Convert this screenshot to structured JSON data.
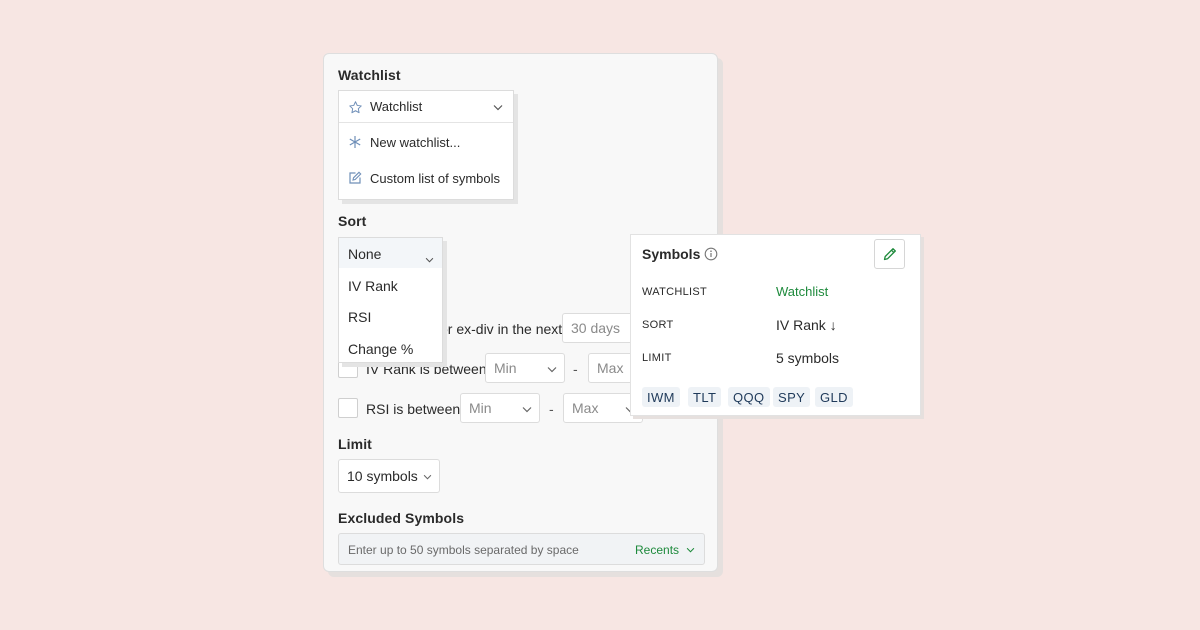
{
  "watchlist": {
    "section_label": "Watchlist",
    "selected": "Watchlist",
    "options": [
      "New watchlist...",
      "Custom list of symbols"
    ]
  },
  "sort": {
    "section_label": "Sort",
    "selected": "None",
    "options": [
      "IV Rank",
      "RSI",
      "Change %"
    ]
  },
  "filters": {
    "earnings_suffix": "or ex-div in the next",
    "earnings_days": "30 days",
    "iv_rank_label": "IV Rank is between",
    "rsi_label": "RSI is between",
    "min_placeholder": "Min",
    "max_placeholder": "Max",
    "dash": "-"
  },
  "limit": {
    "section_label": "Limit",
    "selected": "10 symbols"
  },
  "excluded": {
    "section_label": "Excluded Symbols",
    "placeholder": "Enter up to 50 symbols separated by space",
    "recents_label": "Recents"
  },
  "symbols_card": {
    "title": "Symbols",
    "rows": {
      "watchlist_key": "WATCHLIST",
      "watchlist_val": "Watchlist",
      "sort_key": "SORT",
      "sort_val": "IV Rank ↓",
      "limit_key": "LIMIT",
      "limit_val": "5 symbols"
    },
    "chips": [
      "IWM",
      "TLT",
      "QQQ",
      "SPY",
      "GLD"
    ]
  },
  "colors": {
    "background": "#f7e6e3",
    "accent_green": "#1e8a3c",
    "chip_text": "#1f3a5a",
    "icon_blue": "#6f8fb8"
  },
  "icons": [
    "star-icon",
    "chevron-down-icon",
    "asterisk-icon",
    "edit-icon",
    "info-icon",
    "pencil-icon"
  ]
}
